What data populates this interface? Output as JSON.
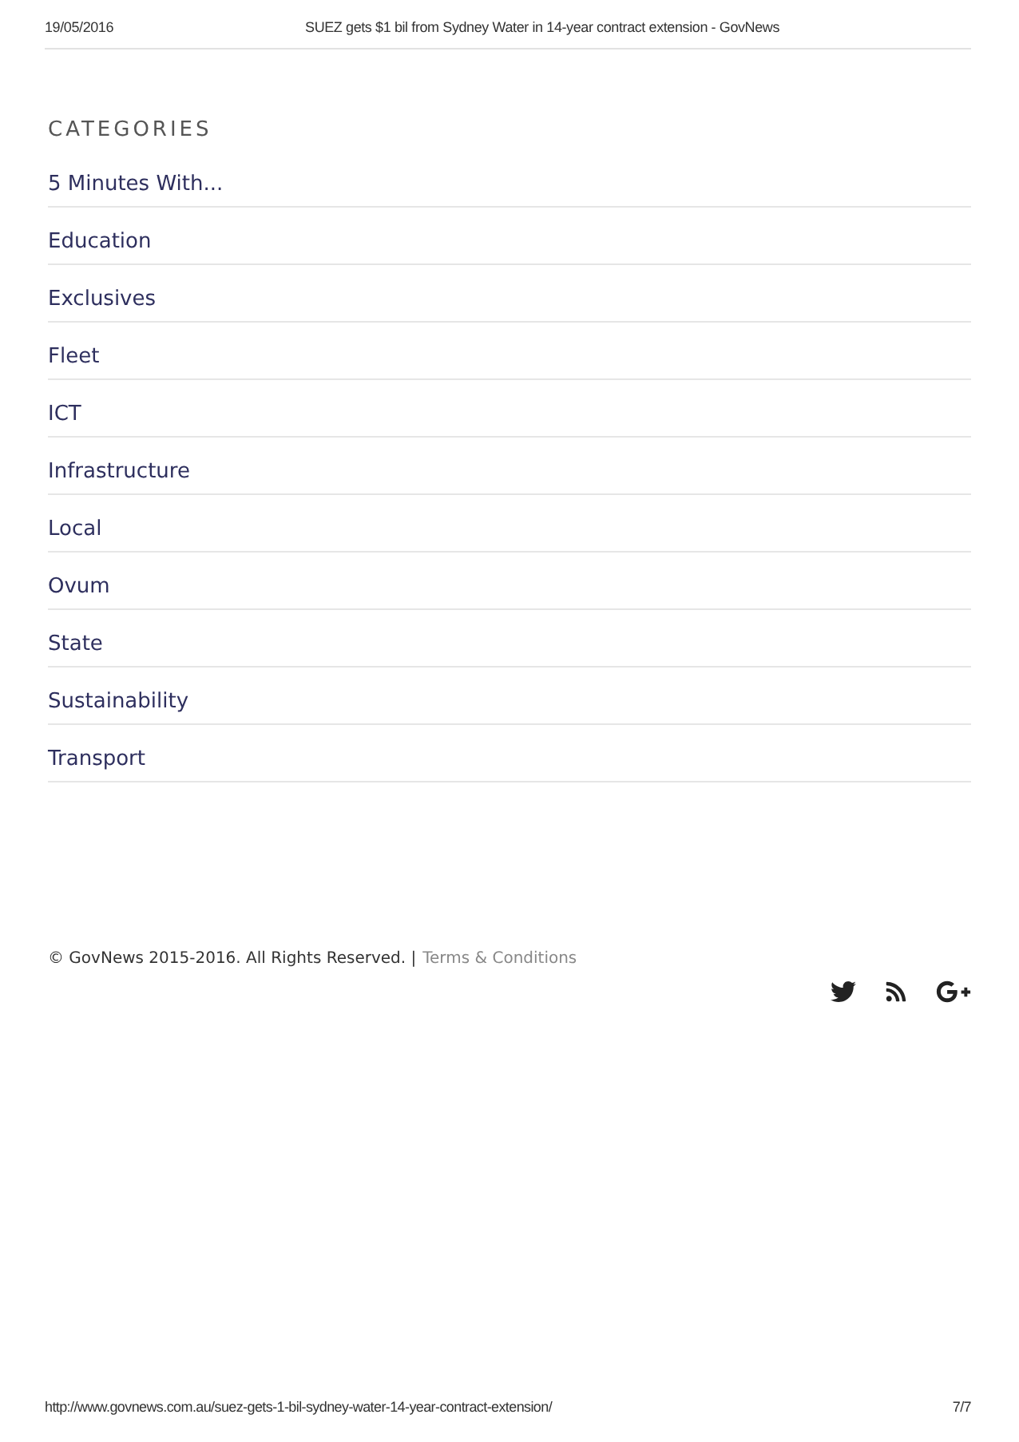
{
  "header": {
    "date": "19/05/2016",
    "title": "SUEZ gets $1 bil from Sydney Water in 14-year contract extension - GovNews"
  },
  "categories": {
    "heading": "CATEGORIES",
    "items": [
      "5 Minutes With...",
      "Education",
      "Exclusives",
      "Fleet",
      "ICT",
      "Infrastructure",
      "Local",
      "Ovum",
      "State",
      "Sustainability",
      "Transport"
    ]
  },
  "footer": {
    "copyright": "© GovNews 2015-2016. All Rights Reserved. |",
    "link": "Terms & Conditions"
  },
  "print_footer": {
    "url": "http://www.govnews.com.au/suez-gets-1-bil-sydney-water-14-year-contract-extension/",
    "page": "7/7"
  }
}
